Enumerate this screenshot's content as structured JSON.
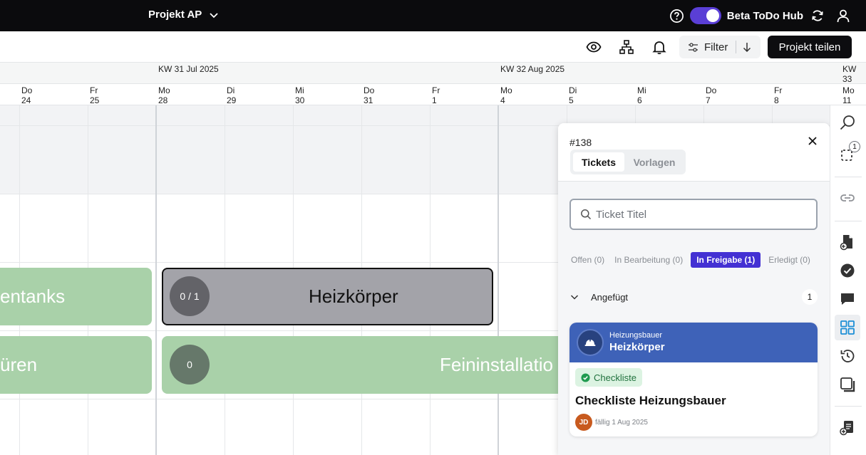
{
  "topbar": {
    "project_name": "Projekt AP",
    "beta_label": "Beta ToDo Hub",
    "beta_enabled": true
  },
  "toolbar": {
    "filter_label": "Filter",
    "share_label": "Projekt teilen"
  },
  "gantt": {
    "weeks": [
      "KW 31 Jul 2025",
      "KW 32 Aug 2025",
      "KW 33"
    ],
    "days": [
      {
        "day": "Do",
        "date": "24"
      },
      {
        "day": "Fr",
        "date": "25"
      },
      {
        "day": "Mo",
        "date": "28"
      },
      {
        "day": "Di",
        "date": "29"
      },
      {
        "day": "Mi",
        "date": "30"
      },
      {
        "day": "Do",
        "date": "31"
      },
      {
        "day": "Fr",
        "date": "1"
      },
      {
        "day": "Mo",
        "date": "4"
      },
      {
        "day": "Di",
        "date": "5"
      },
      {
        "day": "Mi",
        "date": "6"
      },
      {
        "day": "Do",
        "date": "7"
      },
      {
        "day": "Fr",
        "date": "8"
      },
      {
        "day": "Mo",
        "date": "11"
      }
    ],
    "bars": [
      {
        "label": "entanks"
      },
      {
        "label": "Heizkörper",
        "counter": "0 / 1"
      },
      {
        "label": "üren"
      },
      {
        "label": "Feininstallatio",
        "counter": "0"
      }
    ]
  },
  "panel": {
    "ticket_id": "#138",
    "tabs": [
      "Tickets",
      "Vorlagen"
    ],
    "search_placeholder": "Ticket Titel",
    "statuses": [
      "Offen (0)",
      "In Bearbeitung (0)",
      "In Freigabe (1)",
      "Erledigt (0)"
    ],
    "section": {
      "label": "Angefügt",
      "count": "1"
    },
    "card": {
      "trade": "Heizungsbauer",
      "title": "Heizkörper",
      "tag": "Checkliste",
      "heading": "Checkliste Heizungsbauer",
      "assignee_initials": "JD",
      "due": "fällig 1 Aug 2025"
    }
  },
  "rail": {
    "selection_badge": "1"
  },
  "colors": {
    "accent": "#4330d3",
    "toggle": "#5a3fd6",
    "bar_green": "#a9d1a9",
    "bar_gray": "#a3a3a9",
    "card_header": "#3e62b8"
  }
}
